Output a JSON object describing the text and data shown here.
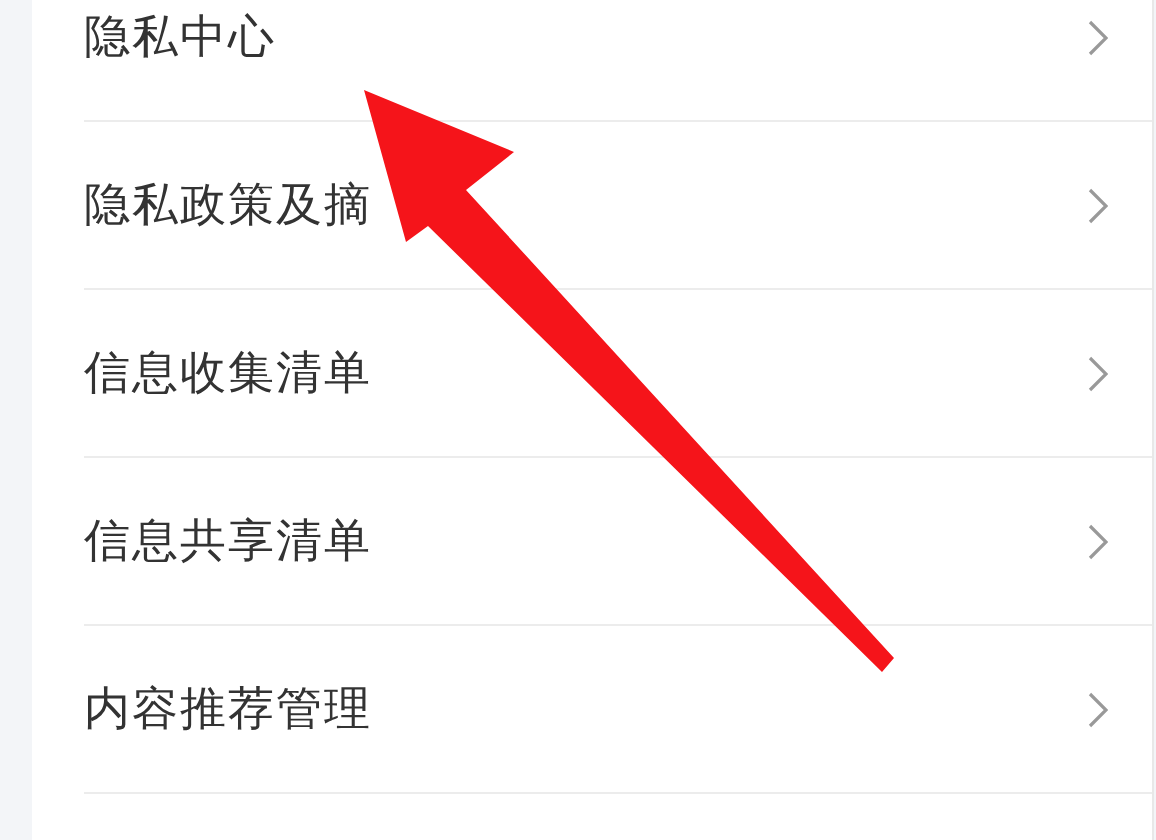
{
  "menu": {
    "items": [
      {
        "label": "隐私中心"
      },
      {
        "label": "隐私政策及摘"
      },
      {
        "label": "信息收集清单"
      },
      {
        "label": "信息共享清单"
      },
      {
        "label": "内容推荐管理"
      }
    ]
  }
}
